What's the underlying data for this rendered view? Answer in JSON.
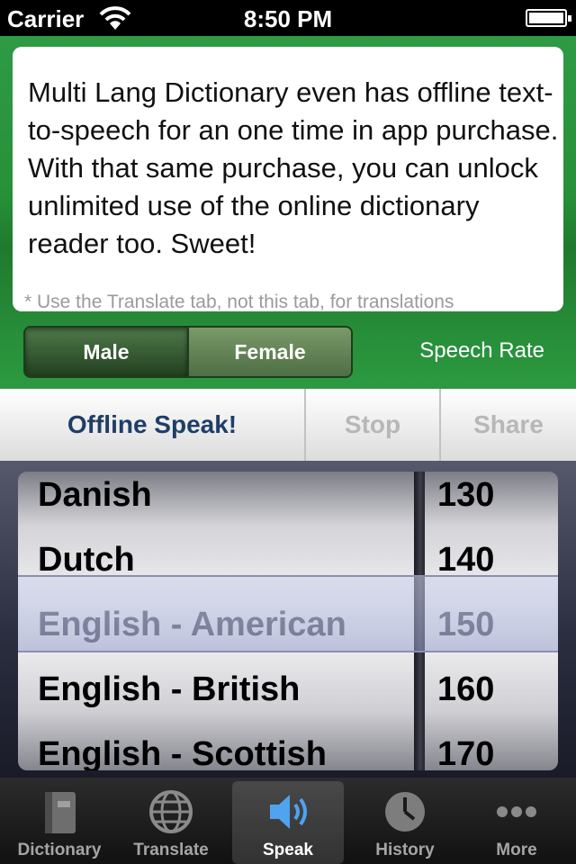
{
  "status_bar": {
    "carrier": "Carrier",
    "time": "8:50 PM"
  },
  "header": {
    "message": "Multi Lang Dictionary even has offline text-to-speech for an one time in app purchase. With that same purchase, you can unlock unlimited use of the online dictionary reader too. Sweet!",
    "hint": "* Use the Translate tab, not this tab, for translations",
    "voice_options": [
      "Male",
      "Female"
    ],
    "selected_voice": "Male",
    "speech_rate_label": "Speech Rate"
  },
  "toolbar": {
    "speak_label": "Offline Speak!",
    "stop_label": "Stop",
    "share_label": "Share"
  },
  "picker": {
    "languages": [
      "Danish",
      "Dutch",
      "English - American",
      "English - British",
      "English - Scottish"
    ],
    "rates": [
      "130",
      "140",
      "150",
      "160",
      "170"
    ],
    "selected_language": "English - American",
    "selected_rate": "150"
  },
  "tabbar": {
    "tabs": [
      {
        "label": "Dictionary",
        "icon": "book-icon"
      },
      {
        "label": "Translate",
        "icon": "globe-icon"
      },
      {
        "label": "Speak",
        "icon": "speaker-icon"
      },
      {
        "label": "History",
        "icon": "clock-icon"
      },
      {
        "label": "More",
        "icon": "more-dots-icon"
      }
    ],
    "active_tab": "Speak"
  },
  "colors": {
    "header_green": "#2f9a45",
    "speak_button_text": "#1f3e66",
    "disabled_text": "#b7b7b7"
  }
}
